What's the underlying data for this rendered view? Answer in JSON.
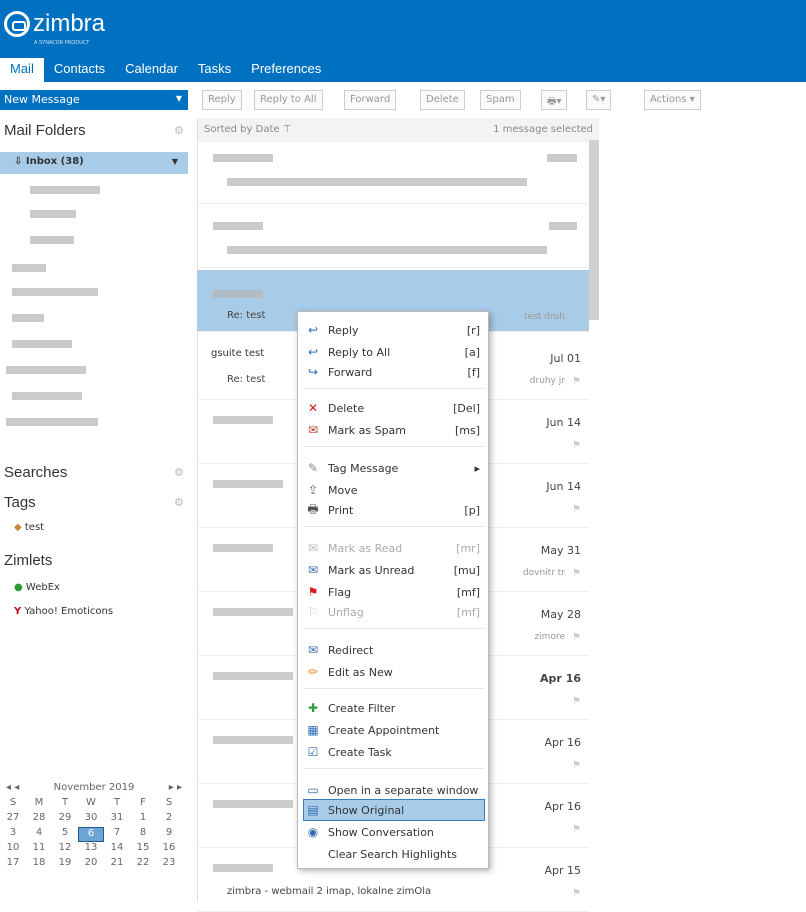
{
  "app": {
    "logo": "zimbra",
    "tagline": "A SYNACOR PRODUCT"
  },
  "tabs": [
    {
      "label": "Mail"
    },
    {
      "label": "Contacts"
    },
    {
      "label": "Calendar"
    },
    {
      "label": "Tasks"
    },
    {
      "label": "Preferences"
    }
  ],
  "toolbar": {
    "new_message": "New Message",
    "reply": "Reply",
    "reply_all": "Reply to All",
    "forward": "Forward",
    "delete": "Delete",
    "spam": "Spam",
    "actions": "Actions"
  },
  "sidebar": {
    "mail_folders": "Mail Folders",
    "inbox": "Inbox (38)",
    "searches": "Searches",
    "tags": "Tags",
    "tag_items": [
      "test"
    ],
    "zimlets": "Zimlets",
    "zimlet_items": [
      "WebEx",
      "Yahoo! Emoticons"
    ]
  },
  "calendar": {
    "month": "November 2019",
    "days": [
      "S",
      "M",
      "T",
      "W",
      "T",
      "F",
      "S"
    ],
    "weeks": [
      [
        "27",
        "28",
        "29",
        "30",
        "31",
        "1",
        "2"
      ],
      [
        "3",
        "4",
        "5",
        "6",
        "7",
        "8",
        "9"
      ],
      [
        "10",
        "11",
        "12",
        "13",
        "14",
        "15",
        "16"
      ],
      [
        "17",
        "18",
        "19",
        "20",
        "21",
        "22",
        "23"
      ]
    ]
  },
  "list": {
    "sorted_by": "Sorted by Date",
    "selected": "1 message selected",
    "messages": [
      {
        "from": "",
        "subject": "",
        "date": ""
      },
      {
        "from": "",
        "subject": "",
        "date": ""
      },
      {
        "from": "",
        "subject": "Re: test",
        "date": "",
        "fragment": "test druh"
      },
      {
        "from": "gsuite test",
        "subject": "Re: test",
        "date": "Jul 01",
        "fragment": "druhy jr"
      },
      {
        "from": "",
        "subject": "",
        "date": "Jun 14"
      },
      {
        "from": "",
        "subject": "",
        "date": "Jun 14"
      },
      {
        "from": "",
        "subject": "",
        "date": "May 31",
        "fragment": "dovnitr tr"
      },
      {
        "from": "",
        "subject": "",
        "date": "May 28",
        "fragment": "zimore"
      },
      {
        "from": "",
        "subject": "",
        "date": "Apr 16"
      },
      {
        "from": "",
        "subject": "",
        "date": "Apr 16"
      },
      {
        "from": "",
        "subject": "",
        "date": "Apr 16"
      },
      {
        "from": "",
        "subject": "zimbra - webmail 2 imap, lokalne zimOla",
        "date": "Apr 15"
      }
    ]
  },
  "context_menu": {
    "items": [
      {
        "label": "Reply",
        "shortcut": "[r]",
        "icon": "reply-icon"
      },
      {
        "label": "Reply to All",
        "shortcut": "[a]",
        "icon": "reply-all-icon"
      },
      {
        "label": "Forward",
        "shortcut": "[f]",
        "icon": "forward-icon"
      },
      {
        "label": "Delete",
        "shortcut": "[Del]",
        "icon": "delete-icon"
      },
      {
        "label": "Mark as Spam",
        "shortcut": "[ms]",
        "icon": "spam-icon"
      },
      {
        "label": "Tag Message",
        "shortcut": "▸",
        "icon": "tag-icon"
      },
      {
        "label": "Move",
        "shortcut": "",
        "icon": "move-icon"
      },
      {
        "label": "Print",
        "shortcut": "[p]",
        "icon": "print-icon"
      },
      {
        "label": "Mark as Read",
        "shortcut": "[mr]",
        "icon": "read-icon"
      },
      {
        "label": "Mark as Unread",
        "shortcut": "[mu]",
        "icon": "unread-icon"
      },
      {
        "label": "Flag",
        "shortcut": "[mf]",
        "icon": "flag-icon"
      },
      {
        "label": "Unflag",
        "shortcut": "[mf]",
        "icon": "unflag-icon"
      },
      {
        "label": "Redirect",
        "shortcut": "",
        "icon": "redirect-icon"
      },
      {
        "label": "Edit as New",
        "shortcut": "",
        "icon": "edit-icon"
      },
      {
        "label": "Create Filter",
        "shortcut": "",
        "icon": "filter-icon"
      },
      {
        "label": "Create Appointment",
        "shortcut": "",
        "icon": "appointment-icon"
      },
      {
        "label": "Create Task",
        "shortcut": "",
        "icon": "task-icon"
      },
      {
        "label": "Open in a separate window",
        "shortcut": "",
        "icon": "window-icon"
      },
      {
        "label": "Show Original",
        "shortcut": "",
        "icon": "original-icon"
      },
      {
        "label": "Show Conversation",
        "shortcut": "",
        "icon": "conversation-icon"
      },
      {
        "label": "Clear Search Highlights",
        "shortcut": "",
        "icon": ""
      }
    ]
  }
}
